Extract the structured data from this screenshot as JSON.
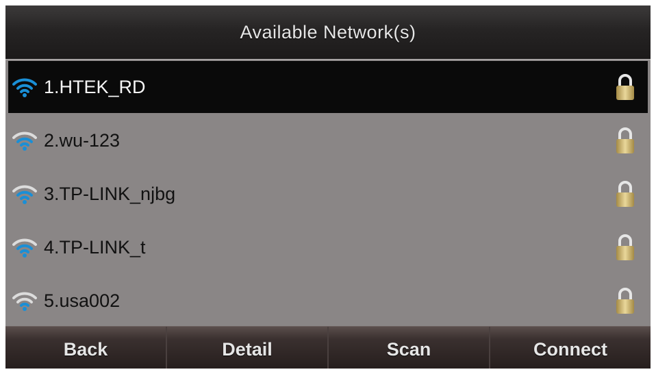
{
  "header": {
    "title": "Available Network(s)"
  },
  "networks": [
    {
      "label": "1.HTEK_RD",
      "secured": true,
      "selected": true
    },
    {
      "label": "2.wu-123",
      "secured": true,
      "selected": false
    },
    {
      "label": "3.TP-LINK_njbg",
      "secured": true,
      "selected": false
    },
    {
      "label": "4.TP-LINK_t",
      "secured": true,
      "selected": false
    },
    {
      "label": "5.usa002",
      "secured": true,
      "selected": false
    }
  ],
  "softkeys": {
    "back": "Back",
    "detail": "Detail",
    "scan": "Scan",
    "connect": "Connect"
  },
  "colors": {
    "wifi_active": "#1a8fd6",
    "wifi_inactive": "#dcdcdc",
    "lock_gold": "#c9b06a",
    "list_background": "#8a8686",
    "selected_row": "#0a0a0a"
  },
  "icons": {
    "signal": "wifi-icon",
    "secured": "lock-icon"
  }
}
